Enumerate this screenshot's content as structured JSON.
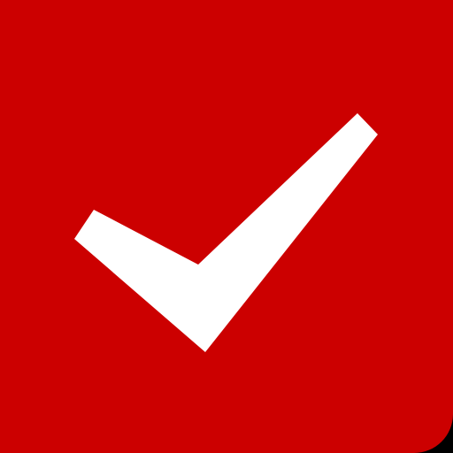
{
  "icon": {
    "name": "checkmark-icon",
    "background_color": "#CC0000",
    "check_color": "#FFFFFF"
  }
}
